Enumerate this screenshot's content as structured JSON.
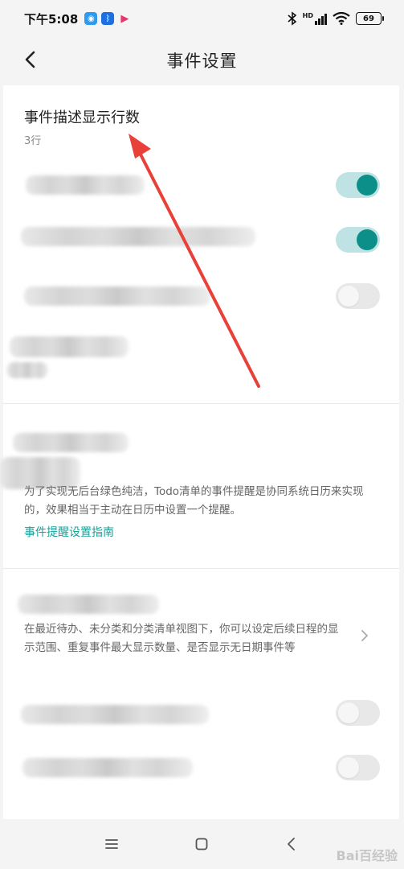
{
  "status_bar": {
    "time": "下午5:08",
    "network": "HD",
    "battery": "69"
  },
  "header": {
    "title": "事件设置"
  },
  "description_lines": {
    "title": "事件描述显示行数",
    "value": "3行"
  },
  "toggles": [
    {
      "state": "on"
    },
    {
      "state": "on"
    },
    {
      "state": "off"
    }
  ],
  "reminder": {
    "description": "为了实现无后台绿色纯洁，Todo清单的事件提醒是协同系统日历来实现的，效果相当于主动在日历中设置一个提醒。",
    "link": "事件提醒设置指南"
  },
  "schedule": {
    "description": "在最近待办、未分类和分类清单视图下，你可以设定后续日程的显示范围、重复事件最大显示数量、是否显示无日期事件等"
  },
  "bottom_toggles": [
    {
      "state": "off"
    },
    {
      "state": "off"
    }
  ],
  "watermark": "Bai百经验",
  "colors": {
    "accent": "#0b8f88",
    "link": "#1a9f98",
    "annotation_arrow": "#e8413a"
  }
}
